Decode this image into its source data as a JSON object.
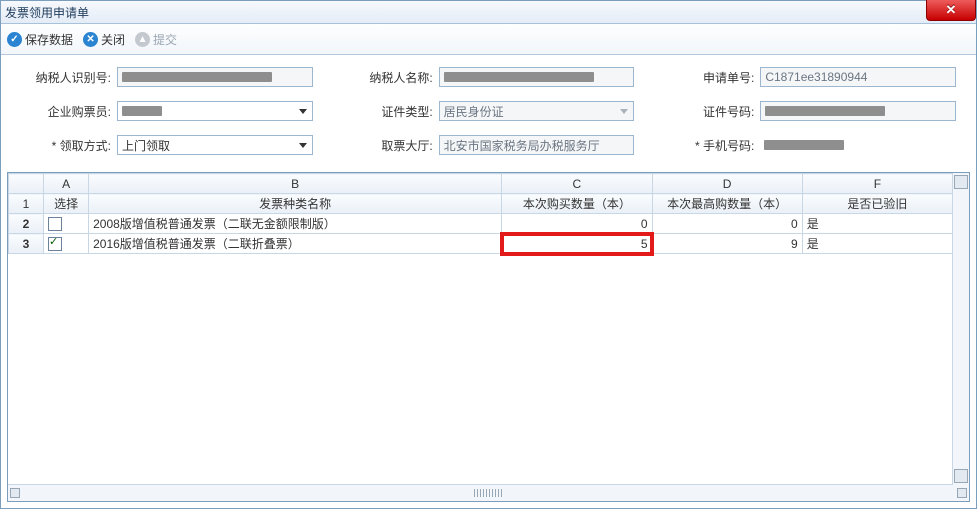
{
  "window": {
    "title": "发票领用申请单"
  },
  "toolbar": {
    "save_label": "保存数据",
    "close_label": "关闭",
    "submit_label": "提交"
  },
  "form": {
    "taxpayer_id": {
      "label": "纳税人识别号:"
    },
    "taxpayer_name": {
      "label": "纳税人名称:"
    },
    "app_no": {
      "label": "申请单号:",
      "value": "C1871ee31890944"
    },
    "purchaser": {
      "label": "企业购票员:"
    },
    "cert_type": {
      "label": "证件类型:",
      "value": "居民身份证"
    },
    "cert_no": {
      "label": "证件号码:"
    },
    "pickup_method": {
      "label": "* 领取方式:",
      "value": "上门领取"
    },
    "pickup_hall": {
      "label": "取票大厅:",
      "value": "北安市国家税务局办税服务厅"
    },
    "phone": {
      "label": "* 手机号码:"
    }
  },
  "grid": {
    "col_letters": {
      "a": "A",
      "b": "B",
      "c": "C",
      "d": "D",
      "f": "F"
    },
    "headers": {
      "select": "选择",
      "name": "发票种类名称",
      "buy_qty": "本次购买数量（本）",
      "max_qty": "本次最高购数量（本）",
      "verified": "是否已验旧"
    },
    "rows": [
      {
        "n": "2",
        "checked": false,
        "name": "2008版增值税普通发票（二联无金额限制版）",
        "buy_qty": "0",
        "max_qty": "0",
        "verified": "是"
      },
      {
        "n": "3",
        "checked": true,
        "name": "2016版增值税普通发票（二联折叠票）",
        "buy_qty": "5",
        "max_qty": "9",
        "verified": "是"
      }
    ],
    "header_rownum": "1"
  }
}
